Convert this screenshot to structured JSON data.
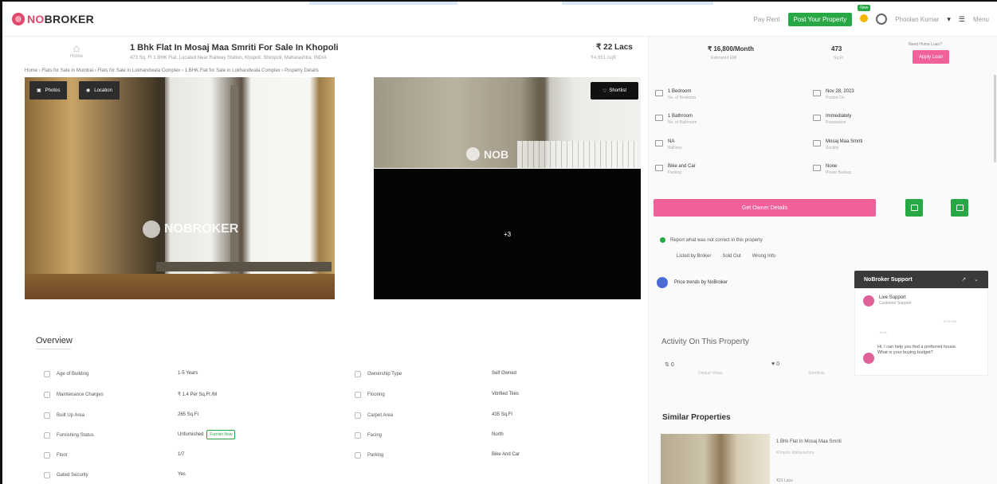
{
  "header": {
    "logo_no": "NO",
    "logo_broker": "BROKER",
    "pay_rent": "Pay Rent",
    "post_property": "Post Your Property",
    "new_badge": "New",
    "user_name": "Phoolan Kumar",
    "menu": "Menu"
  },
  "property": {
    "home_label": "Home",
    "title": "1 Bhk Flat In Mosaj Maa Smriti For Sale In Khopoli",
    "subtitle": "473 Sq. Ft 1 BHK Flat, Located Near Railway Station, Khopoli, Shimpoli, Maharashtra, INDIA",
    "price": "₹ 22 Lacs",
    "price_sub": "₹4,651 /sqft",
    "breadcrumb": "Home › Flats for Sale in Mumbai › Flats for Sale in Lokhandwala Complex › 1 BHK Flat for Sale in Lokhandwala Complex › Property Details"
  },
  "gallery": {
    "photos_btn": "Photos",
    "location_btn": "Location",
    "shortlist_btn": "Shortlist",
    "more_count": "+3",
    "watermark": "NOBROKER",
    "watermark_short": "NOB"
  },
  "overview": {
    "title": "Overview",
    "left": [
      {
        "label": "Age of Building",
        "value": "1-5 Years"
      },
      {
        "label": "Maintenance Charges",
        "value": "₹ 1.4 Per Sq.Ft /M"
      },
      {
        "label": "Built Up Area",
        "value": "265 Sq.Ft"
      },
      {
        "label": "Furnishing Status",
        "value": "Unfurnished",
        "tag": "Furnish Now"
      },
      {
        "label": "Floor",
        "value": "1/7"
      },
      {
        "label": "Gated Security",
        "value": "Yes"
      }
    ],
    "right": [
      {
        "label": "Ownership Type",
        "value": "Self Owned"
      },
      {
        "label": "Flooring",
        "value": "Vitrified Tiles"
      },
      {
        "label": "Carpet Area",
        "value": "435 Sq.Ft"
      },
      {
        "label": "Facing",
        "value": "North"
      },
      {
        "label": "Parking",
        "value": "Bike And Car"
      }
    ]
  },
  "panel": {
    "emi": "₹ 16,800/Month",
    "emi_sub": "Estimated EMI",
    "builtup": "473",
    "builtup_sub": "Sq.Ft",
    "apply_link": "Need Home Loan?",
    "apply_loan": "Apply Loan",
    "features": [
      {
        "main": "1 Bedroom",
        "sub": "No. of Bedroom"
      },
      {
        "main": "Nov 28, 2023",
        "sub": "Posted On"
      },
      {
        "main": "1 Bathroom",
        "sub": "No. of Bathroom"
      },
      {
        "main": "Immediately",
        "sub": "Possession"
      },
      {
        "main": "NA",
        "sub": "Balcony"
      },
      {
        "main": "Mosaj Maa Smriti",
        "sub": "Society"
      },
      {
        "main": "Bike and Car",
        "sub": "Parking"
      },
      {
        "main": "None",
        "sub": "Power Backup"
      }
    ],
    "owner_btn": "Get Owner Details",
    "report": "Report what was not correct in this property",
    "report_options": [
      "Listed by Broker",
      "Sold Out",
      "Wrong Info"
    ],
    "pricetrends": "Price trends by NoBroker",
    "activity_title": "Activity On This Property",
    "views": "0",
    "views_sub": "Unique Views",
    "shortlists": "0",
    "shortlists_sub": "Shortlists",
    "similar_title": "Similar Properties",
    "similar_name": "1 Bhk Flat In Mosaj Maa Smriti",
    "similar_sub": "Khopoli, Maharashtra",
    "similar_price": "₹21 Lacs"
  },
  "chat": {
    "title": "NoBroker Support",
    "controls": "↗ ⌄",
    "agent": "Live Support",
    "role": "Customer Support",
    "time1": "10:41 AM",
    "time2": "10:41",
    "message": "Hi, I can help you find a preferred house. What is your buying budget?"
  }
}
